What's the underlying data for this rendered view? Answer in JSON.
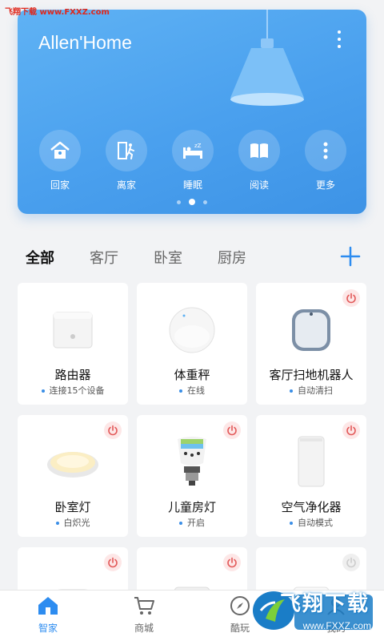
{
  "watermark_top": "飞翔下载 www.FXXZ.com",
  "banner": {
    "home_title": "Allen'Home",
    "scenes": [
      {
        "label": "回家",
        "icon": "home-icon"
      },
      {
        "label": "离家",
        "icon": "leave-icon"
      },
      {
        "label": "睡眠",
        "icon": "sleep-icon"
      },
      {
        "label": "阅读",
        "icon": "book-icon"
      },
      {
        "label": "更多",
        "icon": "more-icon"
      }
    ],
    "pager": {
      "count": 3,
      "active": 1
    }
  },
  "tabs": [
    {
      "label": "全部",
      "active": true
    },
    {
      "label": "客厅",
      "active": false
    },
    {
      "label": "卧室",
      "active": false
    },
    {
      "label": "厨房",
      "active": false
    }
  ],
  "devices": [
    {
      "name": "路由器",
      "status": "连接15个设备",
      "power": null,
      "icon": "router-icon"
    },
    {
      "name": "体重秤",
      "status": "在线",
      "power": null,
      "icon": "scale-icon"
    },
    {
      "name": "客厅扫地机器人",
      "status": "自动清扫",
      "power": "on",
      "icon": "robot-vacuum-icon"
    },
    {
      "name": "卧室灯",
      "status": "白炽光",
      "power": "on",
      "icon": "ceiling-light-icon"
    },
    {
      "name": "儿童房灯",
      "status": "开启",
      "power": "on",
      "icon": "bulb-icon"
    },
    {
      "name": "空气净化器",
      "status": "自动模式",
      "power": "on",
      "icon": "air-purifier-icon"
    },
    {
      "name": "",
      "status": "",
      "power": "on",
      "icon": "speaker-icon"
    },
    {
      "name": "",
      "status": "",
      "power": "on",
      "icon": "socket-icon"
    },
    {
      "name": "",
      "status": "",
      "power": "off",
      "icon": "socket-white-icon"
    }
  ],
  "nav": [
    {
      "label": "智家",
      "active": true,
      "icon": "home-icon"
    },
    {
      "label": "商城",
      "active": false,
      "icon": "cart-icon"
    },
    {
      "label": "酷玩",
      "active": false,
      "icon": "compass-icon"
    },
    {
      "label": "我的",
      "active": false,
      "icon": "user-icon"
    }
  ],
  "watermark_logo": {
    "text": "飞翔下载",
    "url": "www.FXXZ.com"
  },
  "colors": {
    "accent": "#2d8cf0",
    "banner": "#4aa0ee",
    "power_on": "#e25858",
    "power_off": "#cccccc"
  }
}
